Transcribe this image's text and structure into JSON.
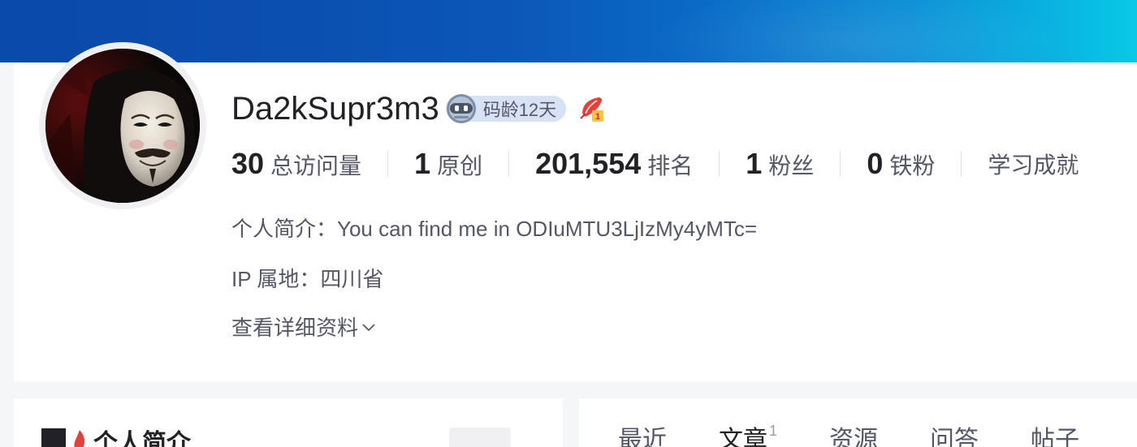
{
  "profile": {
    "username": "Da2kSupr3m3",
    "coding_age": "码龄12天",
    "avatar": "guy-fawkes-mask",
    "stats": [
      {
        "value": "30",
        "label": "总访问量"
      },
      {
        "value": "1",
        "label": "原创"
      },
      {
        "value": "201,554",
        "label": "排名"
      },
      {
        "value": "1",
        "label": "粉丝"
      },
      {
        "value": "0",
        "label": "铁粉"
      }
    ],
    "achievement_label": "学习成就",
    "bio": "个人简介：You can find me in ODIuMTU3LjIzMy4yMTc=",
    "ip_location": "IP 属地：四川省",
    "more_label": "查看详细资料"
  },
  "sidebar_card": {
    "title": "个人简介"
  },
  "content_tabs": [
    {
      "label": "最近",
      "count": ""
    },
    {
      "label": "文章",
      "count": "1"
    },
    {
      "label": "资源",
      "count": ""
    },
    {
      "label": "问答",
      "count": ""
    },
    {
      "label": "帖子",
      "count": ""
    }
  ],
  "colors": {
    "banner_start": "#0a4aa8",
    "banner_end": "#08c9e6",
    "badge_bg": "#d7e3f4",
    "medal_red": "#e5413b"
  }
}
